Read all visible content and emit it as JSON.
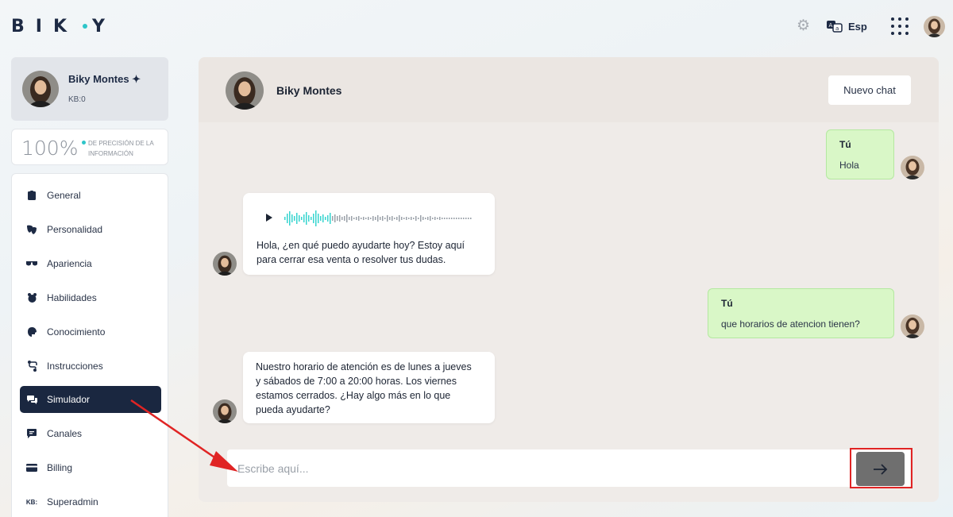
{
  "brand": {
    "logo_text": "BIKY",
    "accent": "#2ec5c9",
    "dark": "#1a2740"
  },
  "topbar": {
    "settings_icon": "gear-icon",
    "language_icon": "translate-icon",
    "language": "Esp",
    "apps_icon": "grid-icon"
  },
  "profile": {
    "name": "Biky Montes ✦",
    "kb": "KB:0"
  },
  "precision": {
    "value": "100%",
    "label": "DE PRECISIÓN DE LA INFORMACIÓN"
  },
  "sidebar": {
    "items": [
      {
        "label": "General",
        "icon": "clipboard-icon",
        "active": false
      },
      {
        "label": "Personalidad",
        "icon": "masks-icon",
        "active": false
      },
      {
        "label": "Apariencia",
        "icon": "sunglasses-icon",
        "active": false
      },
      {
        "label": "Habilidades",
        "icon": "skills-icon",
        "active": false
      },
      {
        "label": "Conocimiento",
        "icon": "brain-icon",
        "active": false
      },
      {
        "label": "Instrucciones",
        "icon": "route-icon",
        "active": false
      },
      {
        "label": "Simulador",
        "icon": "chat-icon",
        "active": true
      },
      {
        "label": "Canales",
        "icon": "message-icon",
        "active": false
      },
      {
        "label": "Billing",
        "icon": "card-icon",
        "active": false
      },
      {
        "label": "Superadmin",
        "icon": "kb-icon",
        "active": false
      }
    ]
  },
  "chat": {
    "header_name": "Biky Montes",
    "new_chat_label": "Nuevo chat",
    "messages": [
      {
        "from": "user",
        "who": "Tú",
        "text": "Hola"
      },
      {
        "from": "bot",
        "audio": true,
        "text": "Hola, ¿en qué puedo ayudarte hoy? Estoy aquí para cerrar esa venta o resolver tus dudas."
      },
      {
        "from": "user",
        "who": "Tú",
        "text": "que horarios de atencion tienen?"
      },
      {
        "from": "bot",
        "text": "Nuestro horario de atención es de lunes a jueves y sábados de 7:00 a 20:00 horas. Los viernes estamos cerrados. ¿Hay algo más en lo que pueda ayudarte?"
      }
    ],
    "input_placeholder": "Escribe aquí...",
    "send_icon": "arrow-right-icon",
    "annotation_color": "#e02424"
  }
}
